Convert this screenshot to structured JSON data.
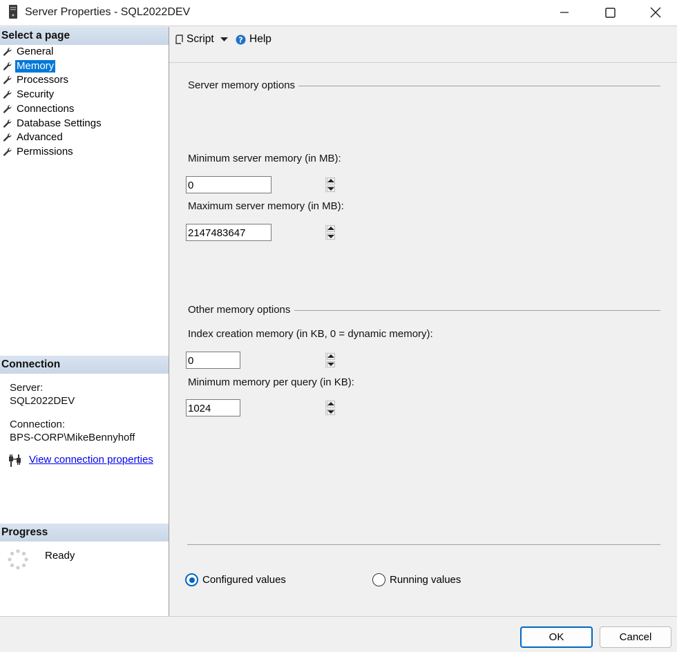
{
  "window": {
    "title": "Server Properties - SQL2022DEV"
  },
  "left": {
    "select_page_header": "Select a page",
    "pages": [
      {
        "label": "General",
        "selected": false
      },
      {
        "label": "Memory",
        "selected": true
      },
      {
        "label": "Processors",
        "selected": false
      },
      {
        "label": "Security",
        "selected": false
      },
      {
        "label": "Connections",
        "selected": false
      },
      {
        "label": "Database Settings",
        "selected": false
      },
      {
        "label": "Advanced",
        "selected": false
      },
      {
        "label": "Permissions",
        "selected": false
      }
    ],
    "connection_header": "Connection",
    "server_label": "Server:",
    "server_value": "SQL2022DEV",
    "connection_label": "Connection:",
    "connection_value": "BPS-CORP\\MikeBennyhoff",
    "view_link": "View connection properties",
    "progress_header": "Progress",
    "progress_status": "Ready"
  },
  "toolbar": {
    "script_label": "Script",
    "help_label": "Help"
  },
  "memory": {
    "server_group_title": "Server memory options",
    "min_label": "Minimum server memory (in MB):",
    "min_value": "0",
    "max_label": "Maximum server memory (in MB):",
    "max_value": "2147483647",
    "other_group_title": "Other memory options",
    "index_label": "Index creation memory (in KB, 0 = dynamic memory):",
    "index_value": "0",
    "query_label": "Minimum memory per query (in KB):",
    "query_value": "1024",
    "radio_configured": "Configured values",
    "radio_running": "Running values",
    "selected_radio": "configured"
  },
  "buttons": {
    "ok": "OK",
    "cancel": "Cancel"
  },
  "colors": {
    "selection": "#0078d7",
    "radio_accent": "#0067c0",
    "link": "#0000ee"
  }
}
